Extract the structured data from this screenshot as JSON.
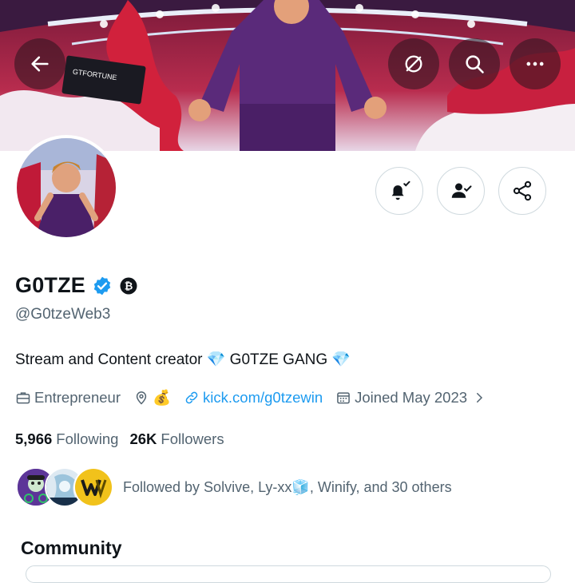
{
  "header": {
    "back_icon": "arrow-left-icon",
    "grok_icon": "slash-circle-icon",
    "search_icon": "search-icon",
    "more_icon": "more-horizontal-icon"
  },
  "profile": {
    "display_name": "G0TZE",
    "verified": true,
    "handle": "@G0tzeWeb3",
    "bio": "Stream and Content creator 💎 G0TZE GANG 💎",
    "category": "Entrepreneur",
    "location": "💰",
    "website": "kick.com/g0tzewin",
    "joined": "Joined May 2023"
  },
  "actions": {
    "notifications_icon": "bell-check-icon",
    "following_icon": "person-check-icon",
    "share_icon": "share-icon"
  },
  "stats": {
    "following_count": "5,966",
    "following_label": "Following",
    "followers_count": "26K",
    "followers_label": "Followers"
  },
  "followed_by": {
    "text": "Followed by Solvive, Ly-xx🧊, Winify, and 30 others"
  },
  "community": {
    "title": "Community"
  },
  "colors": {
    "accent": "#1d9bf0",
    "text_primary": "#0f1419",
    "text_secondary": "#536471",
    "border": "#cfd9de"
  }
}
